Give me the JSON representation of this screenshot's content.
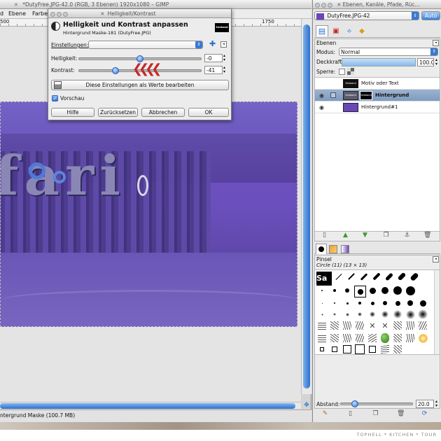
{
  "gimp_window": {
    "title": "*DutyFree.JPG-42.0 (RGB, 3 Ebenen) 1920x1080 – GIMP",
    "menu_items": [
      "d",
      "Ebene",
      "Farbe"
    ],
    "ruler_marks": [
      "500",
      "1750"
    ],
    "status": "ntergrund Maske (100.7 MB)"
  },
  "dialog": {
    "window_title": "Helligkeit/Kontrast",
    "heading": "Helligkeit und Kontrast anpassen",
    "subheading": "Hintergrund Maske-181 (DutyFree.JPG)",
    "thumb_label": "Seeband",
    "settings_label": "Einstellungen:",
    "settings_value": "",
    "brightness_label": "Helligkeit:",
    "brightness_value": "-0",
    "brightness_level": 0.5,
    "contrast_label": "Kontrast:",
    "contrast_value": "-41",
    "contrast_level": 0.3,
    "edit_as_levels": "Diese Einstellungen als Werte bearbeiten",
    "preview_label": "Vorschau",
    "buttons": {
      "help": "Hilfe",
      "reset": "Zurücksetzen",
      "cancel": "Abbrechen",
      "ok": "OK"
    },
    "accent": "#c62828"
  },
  "layers_window": {
    "title": "Ebenen, Kanäle, Pfade, Rüc...",
    "image_select": "DutyFree.JPG-42",
    "auto_button": "Auto",
    "panel_title": "Ebenen",
    "mode_label": "Modus:",
    "mode_value": "Normal",
    "opacity_label": "Deckkraft:",
    "opacity_value": "100.0",
    "lock_label": "Sperre:",
    "layers": [
      {
        "name": "Motiv oder Text",
        "thumb_label": "Seeband",
        "thumb": "#111111",
        "selected": false,
        "visible": false
      },
      {
        "name": "Hintergrund",
        "thumb_label": "Seeband",
        "thumb": "#5d5a70",
        "selected": true,
        "visible": true
      },
      {
        "name": "Hintergrund#1",
        "thumb_label": "",
        "thumb": "#6a47b8",
        "selected": false,
        "visible": true
      }
    ],
    "brushes_title": "Pinsel",
    "brush_name": "Circle (11) (13 × 13)",
    "brush_thumb_label": "Sa",
    "spacing_label": "Abstand:",
    "spacing_value": "20.0",
    "spacing_level": 0.2
  },
  "canvas": {
    "overlay_color": "#6a4fbf",
    "sign_text": "fari"
  },
  "watermark": "TOPHELL * KITCHEN * TOUR"
}
